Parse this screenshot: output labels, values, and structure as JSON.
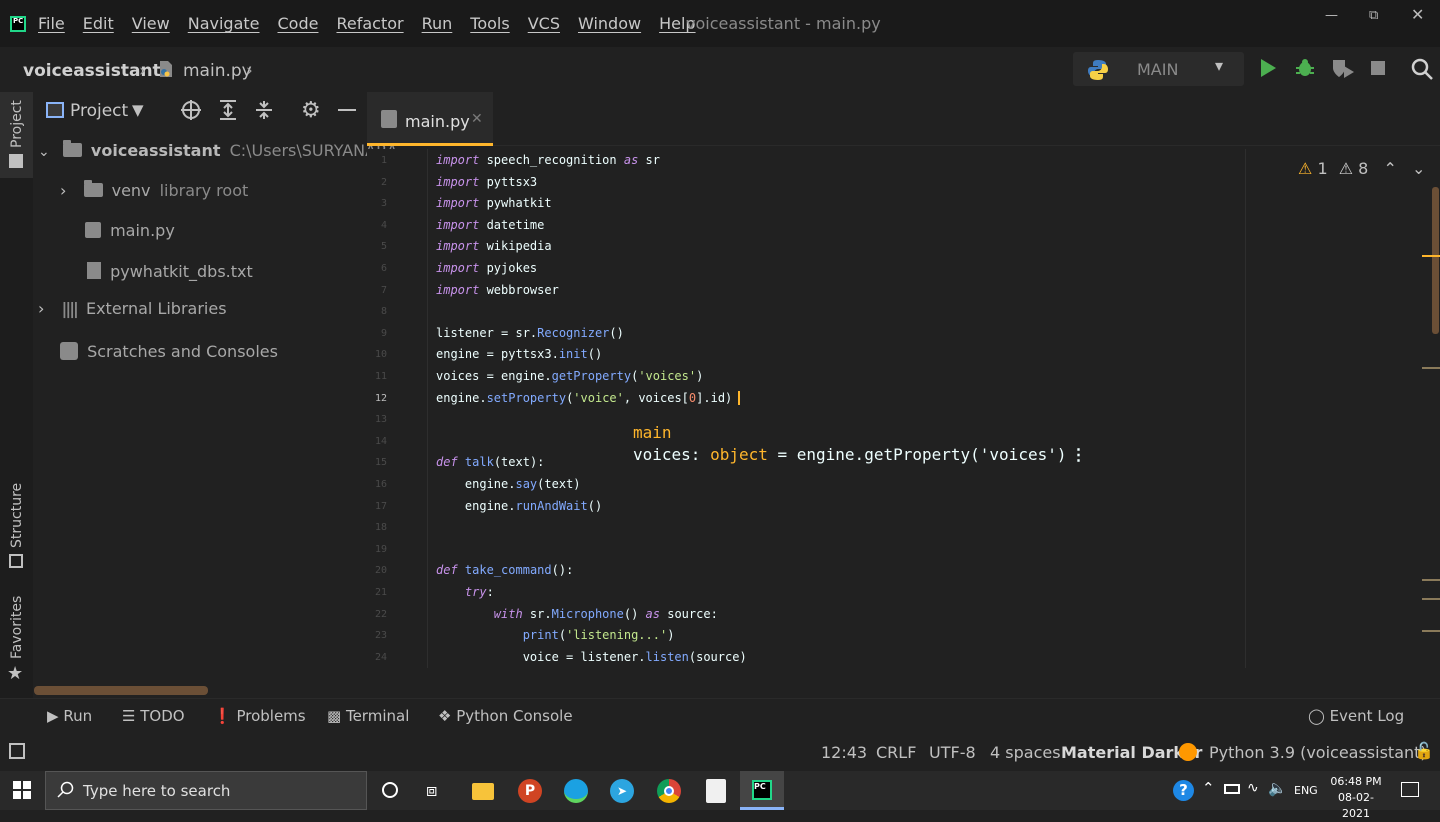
{
  "menubar": {
    "items": [
      "File",
      "Edit",
      "View",
      "Navigate",
      "Code",
      "Refactor",
      "Run",
      "Tools",
      "VCS",
      "Window",
      "Help"
    ],
    "window_title": "voiceassistant - main.py"
  },
  "navbar": {
    "crumb_project": "voiceassistant",
    "crumb_file": "main.py",
    "run_config": "MAIN"
  },
  "sidebar": {
    "project_label": "Project",
    "structure_label": "Structure",
    "favorites_label": "Favorites"
  },
  "project_panel": {
    "title": "Project",
    "root_name": "voiceassistant",
    "root_path": "C:\\Users\\SURYANARA",
    "venv": "venv",
    "venv_note": "library root",
    "file1": "main.py",
    "file2": "pywhatkit_dbs.txt",
    "external_libraries": "External Libraries",
    "scratches": "Scratches and Consoles"
  },
  "editor": {
    "tab_label": "main.py",
    "warnings_count": "1",
    "weak_warnings_count": "8",
    "popup_line1": "main",
    "popup_line2_var": "voices: ",
    "popup_line2_type": "object",
    "popup_line2_rest": " = engine.getProperty('voices')"
  },
  "code_lines": [
    {
      "n": "1",
      "parts": [
        [
          "kw",
          "import"
        ],
        [
          "t",
          " speech_recognition "
        ],
        [
          "kw",
          "as"
        ],
        [
          "t",
          " sr"
        ]
      ]
    },
    {
      "n": "2",
      "parts": [
        [
          "kw",
          "import"
        ],
        [
          "t",
          " pyttsx3"
        ]
      ]
    },
    {
      "n": "3",
      "parts": [
        [
          "kw",
          "import"
        ],
        [
          "t",
          " pywhatkit"
        ]
      ]
    },
    {
      "n": "4",
      "parts": [
        [
          "kw",
          "import"
        ],
        [
          "t",
          " datetime"
        ]
      ]
    },
    {
      "n": "5",
      "parts": [
        [
          "kw",
          "import"
        ],
        [
          "t",
          " wikipedia"
        ]
      ]
    },
    {
      "n": "6",
      "parts": [
        [
          "kw",
          "import"
        ],
        [
          "t",
          " pyjokes"
        ]
      ]
    },
    {
      "n": "7",
      "parts": [
        [
          "kw",
          "import"
        ],
        [
          "t",
          " webbrowser"
        ]
      ]
    },
    {
      "n": "8",
      "parts": []
    },
    {
      "n": "9",
      "parts": [
        [
          "t",
          "listener = sr."
        ],
        [
          "fn",
          "Recognizer"
        ],
        [
          "t",
          "()"
        ]
      ]
    },
    {
      "n": "10",
      "parts": [
        [
          "t",
          "engine = pyttsx3."
        ],
        [
          "fn",
          "init"
        ],
        [
          "t",
          "()"
        ]
      ]
    },
    {
      "n": "11",
      "parts": [
        [
          "t",
          "voices = engine."
        ],
        [
          "fn",
          "getProperty"
        ],
        [
          "t",
          "("
        ],
        [
          "str",
          "'voices'"
        ],
        [
          "t",
          ")"
        ]
      ]
    },
    {
      "n": "12",
      "parts": [
        [
          "t",
          "engine."
        ],
        [
          "fn",
          "setProperty"
        ],
        [
          "t",
          "("
        ],
        [
          "str",
          "'voice'"
        ],
        [
          "t",
          ", voices["
        ],
        [
          "num",
          "0"
        ],
        [
          "t",
          "].id)"
        ]
      ]
    },
    {
      "n": "13",
      "parts": []
    },
    {
      "n": "14",
      "parts": []
    },
    {
      "n": "15",
      "parts": [
        [
          "kw",
          "def"
        ],
        [
          "t",
          " "
        ],
        [
          "fn",
          "talk"
        ],
        [
          "t",
          "(text):"
        ]
      ]
    },
    {
      "n": "16",
      "parts": [
        [
          "t",
          "    engine."
        ],
        [
          "fn",
          "say"
        ],
        [
          "t",
          "(text)"
        ]
      ]
    },
    {
      "n": "17",
      "parts": [
        [
          "t",
          "    engine."
        ],
        [
          "fn",
          "runAndWait"
        ],
        [
          "t",
          "()"
        ]
      ]
    },
    {
      "n": "18",
      "parts": []
    },
    {
      "n": "19",
      "parts": []
    },
    {
      "n": "20",
      "parts": [
        [
          "kw",
          "def"
        ],
        [
          "t",
          " "
        ],
        [
          "fn",
          "take_command"
        ],
        [
          "t",
          "():"
        ]
      ]
    },
    {
      "n": "21",
      "parts": [
        [
          "t",
          "    "
        ],
        [
          "kw",
          "try"
        ],
        [
          "t",
          ":"
        ]
      ]
    },
    {
      "n": "22",
      "parts": [
        [
          "t",
          "        "
        ],
        [
          "kw",
          "with"
        ],
        [
          "t",
          " sr."
        ],
        [
          "fn",
          "Microphone"
        ],
        [
          "t",
          "() "
        ],
        [
          "kw",
          "as"
        ],
        [
          "t",
          " source:"
        ]
      ]
    },
    {
      "n": "23",
      "parts": [
        [
          "t",
          "            "
        ],
        [
          "fn",
          "print"
        ],
        [
          "t",
          "("
        ],
        [
          "str",
          "'listening...'"
        ],
        [
          "t",
          ")"
        ]
      ]
    },
    {
      "n": "24",
      "parts": [
        [
          "t",
          "            voice = listener."
        ],
        [
          "fn",
          "listen"
        ],
        [
          "t",
          "(source)"
        ]
      ]
    }
  ],
  "tool_windows": {
    "run": "Run",
    "todo": "TODO",
    "problems": "Problems",
    "terminal": "Terminal",
    "python_console": "Python Console",
    "event_log": "Event Log"
  },
  "statusbar": {
    "position": "12:43",
    "line_sep": "CRLF",
    "encoding": "UTF-8",
    "indent": "4 spaces",
    "theme": "Material Darker",
    "interpreter": "Python 3.9 (voiceassistant)"
  },
  "taskbar": {
    "search_placeholder": "Type here to search",
    "lang": "ENG",
    "time": "06:48 PM",
    "date": "08-02-2021"
  },
  "colors": {
    "accent": "#ffb62c",
    "run_green": "#4caf50",
    "keyword": "#c792ea",
    "function": "#82aaff",
    "string": "#c3e88d"
  }
}
